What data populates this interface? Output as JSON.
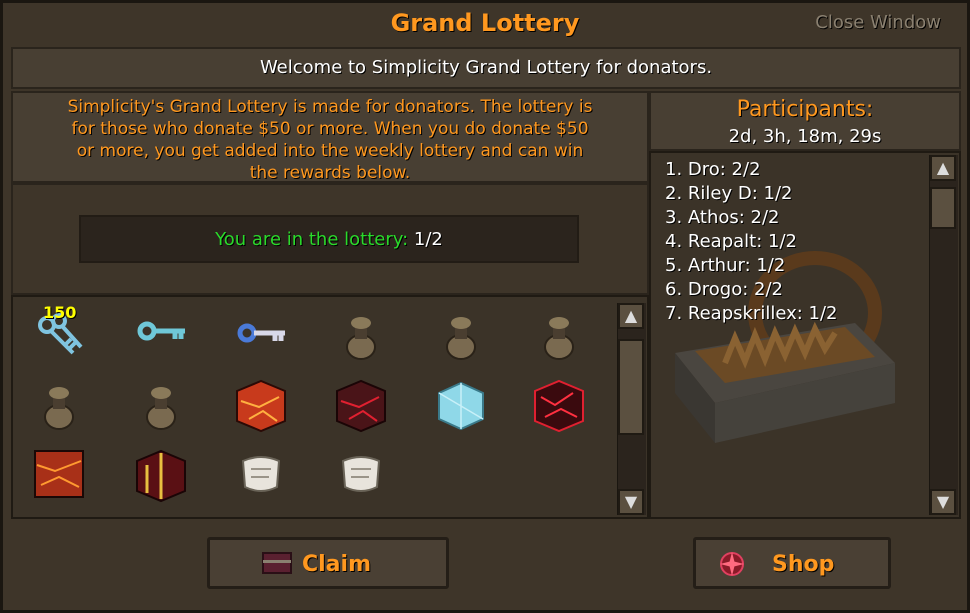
{
  "window": {
    "title": "Grand Lottery",
    "close_label": "Close Window"
  },
  "welcome": "Welcome to Simplicity Grand Lottery for donators.",
  "description": [
    "Simplicity's Grand Lottery is made for donators. The lottery is",
    "for those who donate $50 or more. When you do donate $50",
    "or more, you get added into the weekly lottery and can win",
    "the rewards below."
  ],
  "status": {
    "label": "You are in the lottery:",
    "value": "1/2"
  },
  "rewards": [
    {
      "icon": "keys-icon",
      "qty": "150"
    },
    {
      "icon": "crystal-key-icon"
    },
    {
      "icon": "key-icon"
    },
    {
      "icon": "pouch-icon"
    },
    {
      "icon": "pouch-icon"
    },
    {
      "icon": "pouch-icon"
    },
    {
      "icon": "pouch-icon"
    },
    {
      "icon": "pouch-icon"
    },
    {
      "icon": "lava-box-icon"
    },
    {
      "icon": "dark-lava-box-icon"
    },
    {
      "icon": "ice-box-icon"
    },
    {
      "icon": "blood-box-icon"
    },
    {
      "icon": "lava-cube-icon"
    },
    {
      "icon": "gold-box-icon"
    },
    {
      "icon": "scroll-icon"
    },
    {
      "icon": "scroll-icon"
    }
  ],
  "participants": {
    "title": "Participants:",
    "timer": "2d, 3h, 18m, 29s",
    "entries": [
      "1. Dro: 2/2",
      "2. Riley D: 1/2",
      "3. Athos: 2/2",
      "4. Reapalt: 1/2",
      "5. Arthur: 1/2",
      "6. Drogo: 2/2",
      "7. Reapskrillex: 1/2"
    ]
  },
  "buttons": {
    "claim": "Claim",
    "shop": "Shop"
  },
  "colors": {
    "title_orange": "#ff981f",
    "status_green": "#2bd92b",
    "qty_yellow": "#ffff00"
  }
}
